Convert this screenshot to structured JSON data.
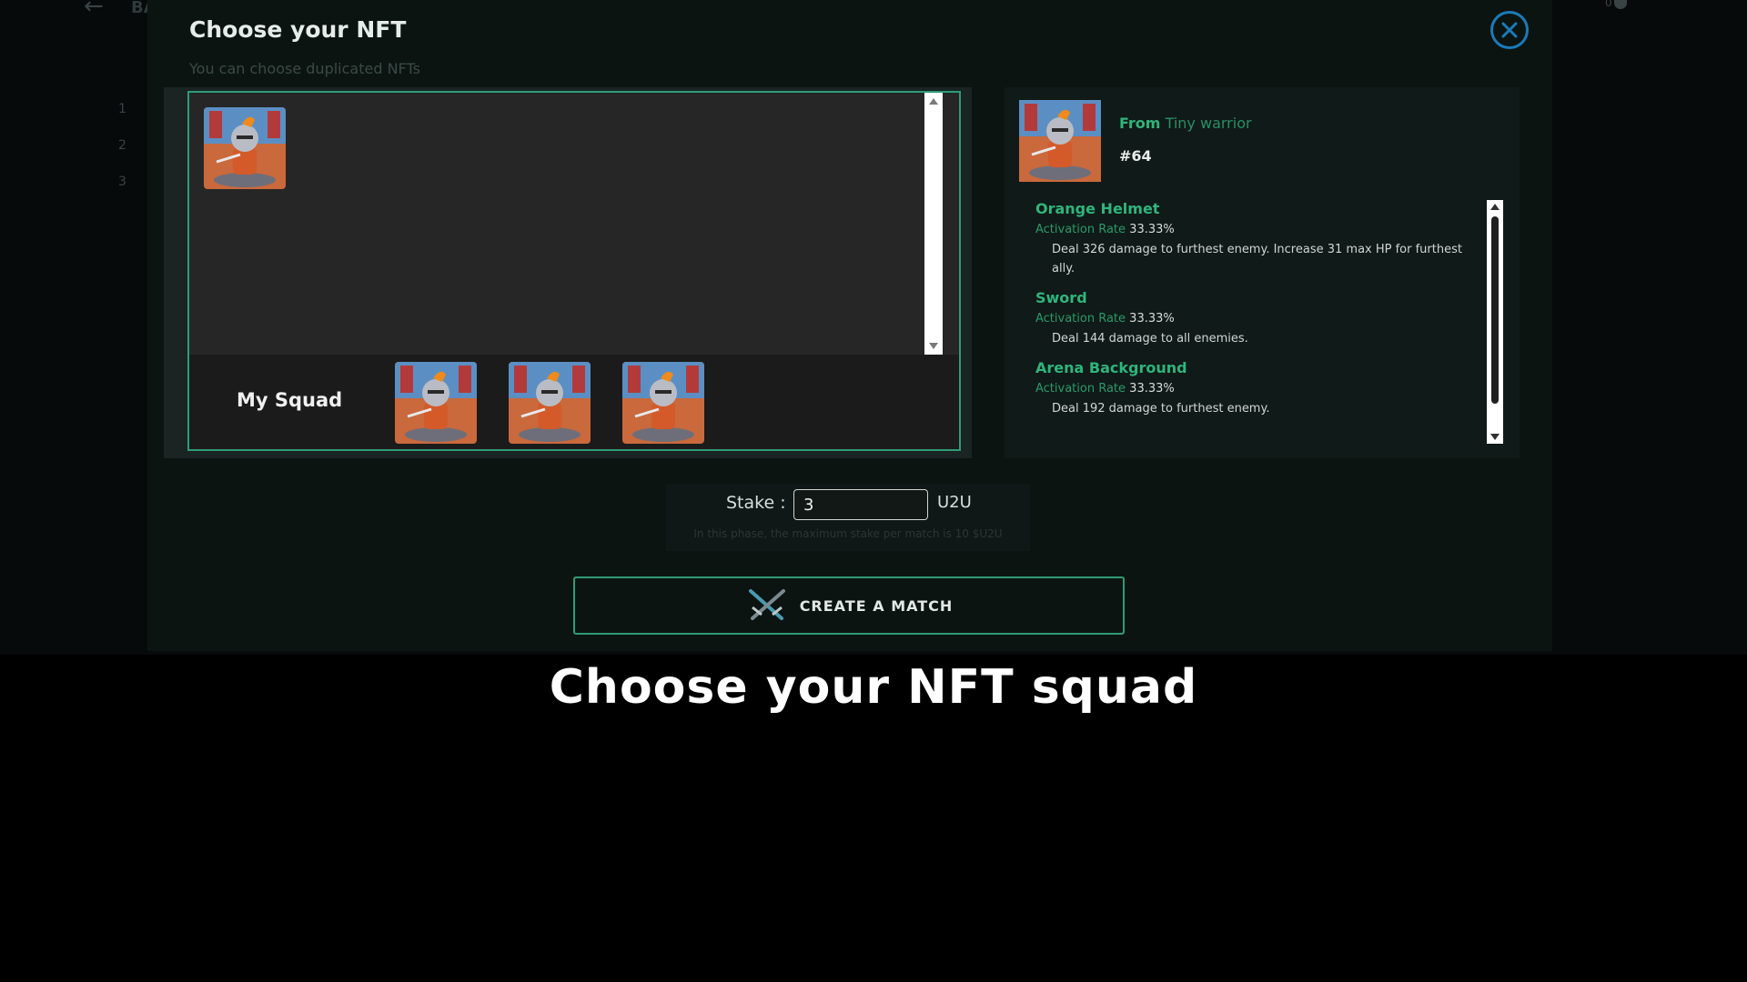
{
  "background": {
    "back_label": "BA",
    "ranks": [
      "1",
      "2",
      "3"
    ],
    "count": "0"
  },
  "modal": {
    "title": "Choose your NFT",
    "subtitle": "You can choose duplicated NFTs",
    "close_icon": "close-icon"
  },
  "nft_list": {
    "items": [
      {
        "name": "Tiny warrior"
      }
    ]
  },
  "squad": {
    "label": "My Squad",
    "members": [
      {
        "name": "Tiny warrior"
      },
      {
        "name": "Tiny warrior"
      },
      {
        "name": "Tiny warrior"
      }
    ]
  },
  "detail": {
    "from_label": "From",
    "collection": "Tiny warrior",
    "id": "#64",
    "skills": [
      {
        "name": "Orange Helmet",
        "rate_label": "Activation Rate",
        "rate": "33.33%",
        "description": "Deal 326 damage to furthest enemy. Increase 31 max HP for furthest ally."
      },
      {
        "name": "Sword",
        "rate_label": "Activation Rate",
        "rate": "33.33%",
        "description": "Deal 144 damage to all enemies."
      },
      {
        "name": "Arena Background",
        "rate_label": "Activation Rate",
        "rate": "33.33%",
        "description": "Deal 192 damage to furthest enemy."
      }
    ]
  },
  "stake": {
    "label": "Stake :",
    "value": "3",
    "unit": "U2U",
    "note": "In this phase, the maximum stake per match is 10 $U2U"
  },
  "create_button": {
    "label": "CREATE A MATCH",
    "icon": "crossed-swords-icon"
  },
  "caption": "Choose your NFT squad",
  "colors": {
    "accent": "#2f9b77",
    "accent_text": "#2fb57c",
    "close": "#1c7ab8"
  }
}
